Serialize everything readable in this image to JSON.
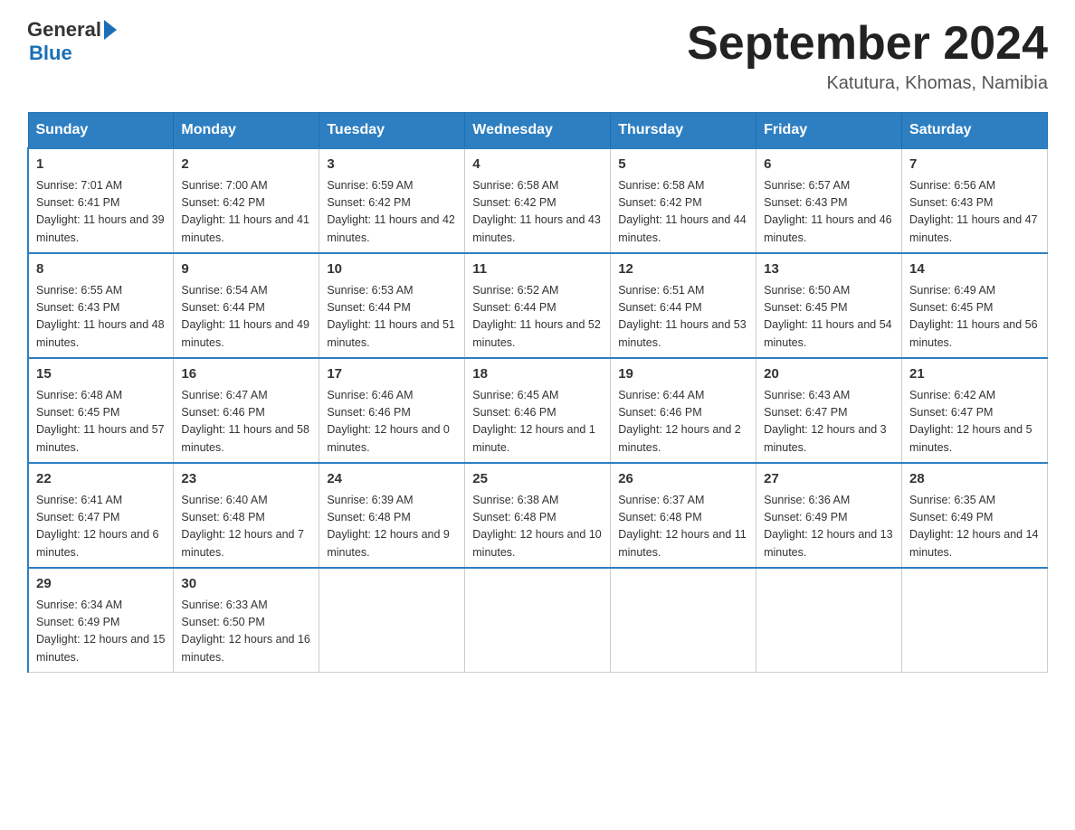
{
  "header": {
    "logo_general": "General",
    "logo_blue": "Blue",
    "month_title": "September 2024",
    "location": "Katutura, Khomas, Namibia"
  },
  "days_of_week": [
    "Sunday",
    "Monday",
    "Tuesday",
    "Wednesday",
    "Thursday",
    "Friday",
    "Saturday"
  ],
  "weeks": [
    [
      {
        "day": "1",
        "sunrise": "7:01 AM",
        "sunset": "6:41 PM",
        "daylight": "11 hours and 39 minutes."
      },
      {
        "day": "2",
        "sunrise": "7:00 AM",
        "sunset": "6:42 PM",
        "daylight": "11 hours and 41 minutes."
      },
      {
        "day": "3",
        "sunrise": "6:59 AM",
        "sunset": "6:42 PM",
        "daylight": "11 hours and 42 minutes."
      },
      {
        "day": "4",
        "sunrise": "6:58 AM",
        "sunset": "6:42 PM",
        "daylight": "11 hours and 43 minutes."
      },
      {
        "day": "5",
        "sunrise": "6:58 AM",
        "sunset": "6:42 PM",
        "daylight": "11 hours and 44 minutes."
      },
      {
        "day": "6",
        "sunrise": "6:57 AM",
        "sunset": "6:43 PM",
        "daylight": "11 hours and 46 minutes."
      },
      {
        "day": "7",
        "sunrise": "6:56 AM",
        "sunset": "6:43 PM",
        "daylight": "11 hours and 47 minutes."
      }
    ],
    [
      {
        "day": "8",
        "sunrise": "6:55 AM",
        "sunset": "6:43 PM",
        "daylight": "11 hours and 48 minutes."
      },
      {
        "day": "9",
        "sunrise": "6:54 AM",
        "sunset": "6:44 PM",
        "daylight": "11 hours and 49 minutes."
      },
      {
        "day": "10",
        "sunrise": "6:53 AM",
        "sunset": "6:44 PM",
        "daylight": "11 hours and 51 minutes."
      },
      {
        "day": "11",
        "sunrise": "6:52 AM",
        "sunset": "6:44 PM",
        "daylight": "11 hours and 52 minutes."
      },
      {
        "day": "12",
        "sunrise": "6:51 AM",
        "sunset": "6:44 PM",
        "daylight": "11 hours and 53 minutes."
      },
      {
        "day": "13",
        "sunrise": "6:50 AM",
        "sunset": "6:45 PM",
        "daylight": "11 hours and 54 minutes."
      },
      {
        "day": "14",
        "sunrise": "6:49 AM",
        "sunset": "6:45 PM",
        "daylight": "11 hours and 56 minutes."
      }
    ],
    [
      {
        "day": "15",
        "sunrise": "6:48 AM",
        "sunset": "6:45 PM",
        "daylight": "11 hours and 57 minutes."
      },
      {
        "day": "16",
        "sunrise": "6:47 AM",
        "sunset": "6:46 PM",
        "daylight": "11 hours and 58 minutes."
      },
      {
        "day": "17",
        "sunrise": "6:46 AM",
        "sunset": "6:46 PM",
        "daylight": "12 hours and 0 minutes."
      },
      {
        "day": "18",
        "sunrise": "6:45 AM",
        "sunset": "6:46 PM",
        "daylight": "12 hours and 1 minute."
      },
      {
        "day": "19",
        "sunrise": "6:44 AM",
        "sunset": "6:46 PM",
        "daylight": "12 hours and 2 minutes."
      },
      {
        "day": "20",
        "sunrise": "6:43 AM",
        "sunset": "6:47 PM",
        "daylight": "12 hours and 3 minutes."
      },
      {
        "day": "21",
        "sunrise": "6:42 AM",
        "sunset": "6:47 PM",
        "daylight": "12 hours and 5 minutes."
      }
    ],
    [
      {
        "day": "22",
        "sunrise": "6:41 AM",
        "sunset": "6:47 PM",
        "daylight": "12 hours and 6 minutes."
      },
      {
        "day": "23",
        "sunrise": "6:40 AM",
        "sunset": "6:48 PM",
        "daylight": "12 hours and 7 minutes."
      },
      {
        "day": "24",
        "sunrise": "6:39 AM",
        "sunset": "6:48 PM",
        "daylight": "12 hours and 9 minutes."
      },
      {
        "day": "25",
        "sunrise": "6:38 AM",
        "sunset": "6:48 PM",
        "daylight": "12 hours and 10 minutes."
      },
      {
        "day": "26",
        "sunrise": "6:37 AM",
        "sunset": "6:48 PM",
        "daylight": "12 hours and 11 minutes."
      },
      {
        "day": "27",
        "sunrise": "6:36 AM",
        "sunset": "6:49 PM",
        "daylight": "12 hours and 13 minutes."
      },
      {
        "day": "28",
        "sunrise": "6:35 AM",
        "sunset": "6:49 PM",
        "daylight": "12 hours and 14 minutes."
      }
    ],
    [
      {
        "day": "29",
        "sunrise": "6:34 AM",
        "sunset": "6:49 PM",
        "daylight": "12 hours and 15 minutes."
      },
      {
        "day": "30",
        "sunrise": "6:33 AM",
        "sunset": "6:50 PM",
        "daylight": "12 hours and 16 minutes."
      },
      null,
      null,
      null,
      null,
      null
    ]
  ],
  "labels": {
    "sunrise": "Sunrise:",
    "sunset": "Sunset:",
    "daylight": "Daylight:"
  }
}
